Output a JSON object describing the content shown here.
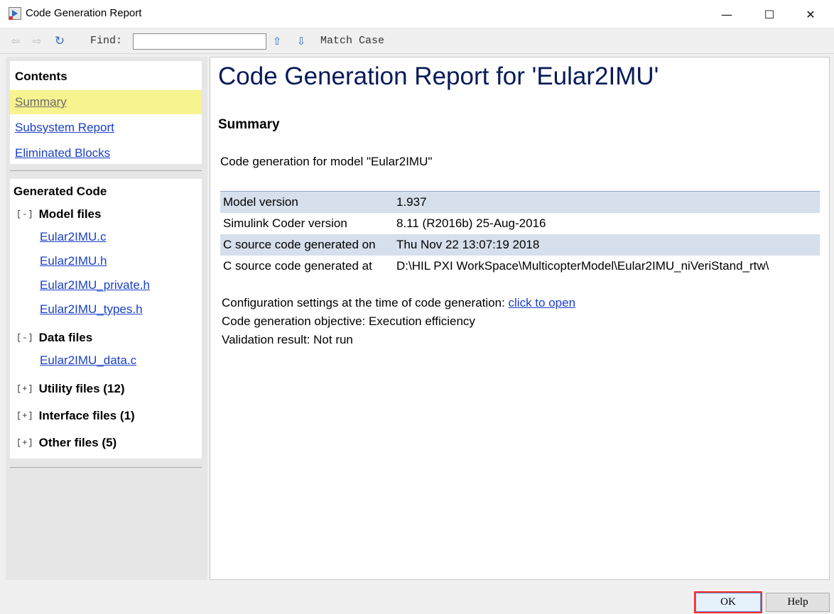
{
  "window": {
    "title": "Code Generation Report",
    "minimize_glyph": "—",
    "maximize_glyph": "☐",
    "close_glyph": "✕"
  },
  "toolbar": {
    "find_label": "Find:",
    "find_value": "",
    "match_case_label": "Match Case",
    "icons": [
      "back-arrow-icon",
      "forward-arrow-icon",
      "refresh-icon",
      "up-arrow-icon",
      "down-arrow-icon"
    ]
  },
  "contents": {
    "heading": "Contents",
    "items": [
      {
        "label": "Summary"
      },
      {
        "label": "Subsystem Report"
      },
      {
        "label": "Eliminated Blocks"
      }
    ]
  },
  "generated_code": {
    "heading": "Generated Code",
    "groups": [
      {
        "toggle": "[-]",
        "label": "Model files",
        "files": [
          "Eular2IMU.c",
          "Eular2IMU.h",
          "Eular2IMU_private.h",
          "Eular2IMU_types.h"
        ]
      },
      {
        "toggle": "[-]",
        "label": "Data files",
        "files": [
          "Eular2IMU_data.c"
        ]
      },
      {
        "toggle": "[+]",
        "label": "Utility files (12)",
        "files": []
      },
      {
        "toggle": "[+]",
        "label": "Interface files (1)",
        "files": []
      },
      {
        "toggle": "[+]",
        "label": "Other files (5)",
        "files": []
      }
    ]
  },
  "report": {
    "title": "Code Generation Report for 'Eular2IMU'",
    "section": "Summary",
    "intro": "Code generation for model \"Eular2IMU\"",
    "table": [
      {
        "key": "Model version",
        "value": "1.937"
      },
      {
        "key": "Simulink Coder version",
        "value": "8.11 (R2016b) 25-Aug-2016"
      },
      {
        "key": "C source code generated on",
        "value": "Thu Nov 22 13:07:19 2018"
      },
      {
        "key": "C source code generated at",
        "value": "D:\\HIL PXI WorkSpace\\MulticopterModel\\Eular2IMU_niVeriStand_rtw\\"
      }
    ],
    "config_text": "Configuration settings at the time of code generation: ",
    "config_link": "click to open",
    "objective": "Code generation objective: Execution efficiency",
    "validation": "Validation result: Not run"
  },
  "buttons": {
    "ok": "OK",
    "help": "Help"
  },
  "colors": {
    "title_color": "#061a59",
    "link_color": "#1a40c8",
    "selected_bg": "#f7f38f",
    "table_shade": "#d6dfec",
    "ok_highlight": "#ff2a2a"
  }
}
